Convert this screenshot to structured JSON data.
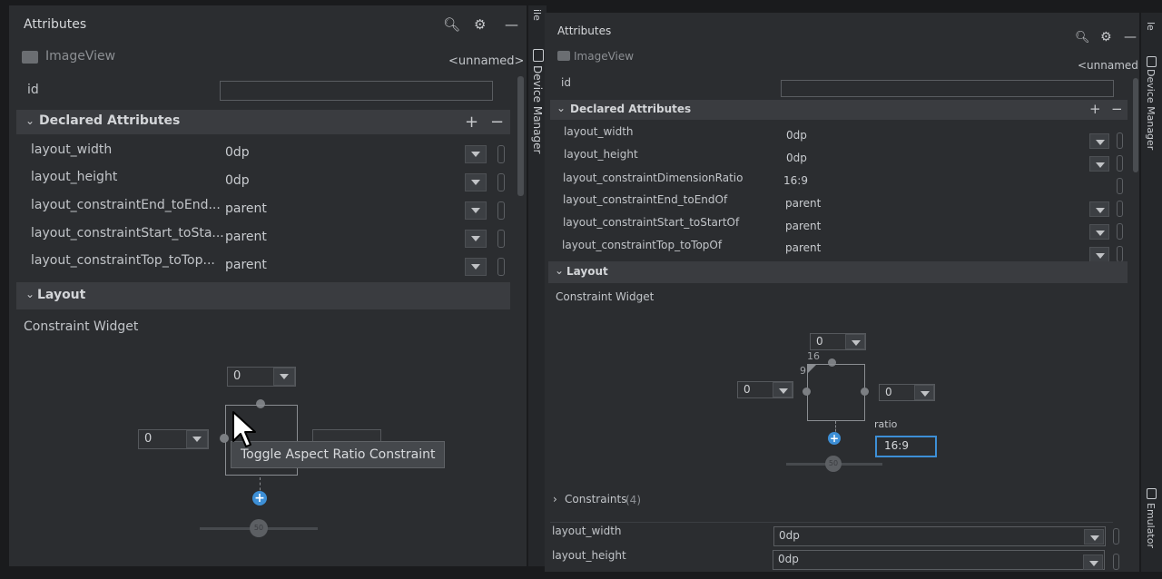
{
  "left": {
    "title": "Attributes",
    "component": "ImageView",
    "name": "<unnamed>",
    "id_label": "id",
    "declared_title": "Declared Attributes",
    "attributes": [
      {
        "name": "layout_width",
        "value": "0dp"
      },
      {
        "name": "layout_height",
        "value": "0dp"
      },
      {
        "name": "layout_constraintEnd_toEnd...",
        "value": "parent"
      },
      {
        "name": "layout_constraintStart_toSta...",
        "value": "parent"
      },
      {
        "name": "layout_constraintTop_toTop...",
        "value": "parent"
      }
    ],
    "layout_title": "Layout",
    "constraint_widget": "Constraint Widget",
    "margin_top": "0",
    "margin_left": "0",
    "bias": "50",
    "tooltip": "Toggle Aspect Ratio Constraint"
  },
  "right": {
    "title": "Attributes",
    "component": "ImageView",
    "name": "<unnamed>",
    "id_label": "id",
    "declared_title": "Declared Attributes",
    "attributes": [
      {
        "name": "layout_width",
        "value": "0dp"
      },
      {
        "name": "layout_height",
        "value": "0dp"
      },
      {
        "name": "layout_constraintDimensionRatio",
        "value": "16:9"
      },
      {
        "name": "layout_constraintEnd_toEndOf",
        "value": "parent"
      },
      {
        "name": "layout_constraintStart_toStartOf",
        "value": "parent"
      },
      {
        "name": "layout_constraintTop_toTopOf",
        "value": "parent"
      }
    ],
    "layout_title": "Layout",
    "constraint_widget": "Constraint Widget",
    "margin_top": "0",
    "margin_left": "0",
    "margin_right": "0",
    "ratio_w": "16",
    "ratio_h": "9",
    "ratio_label": "ratio",
    "ratio_value": "16:9",
    "bias": "50",
    "constraints_label": "Constraints",
    "constraints_count": "(4)",
    "bottom_rows": [
      {
        "name": "layout_width",
        "value": "0dp"
      },
      {
        "name": "layout_height",
        "value": "0dp"
      }
    ]
  },
  "side": {
    "device_manager": "Device Manager",
    "emulator": "Emulator",
    "cut_label": "ile",
    "cut_label_right": "le"
  }
}
